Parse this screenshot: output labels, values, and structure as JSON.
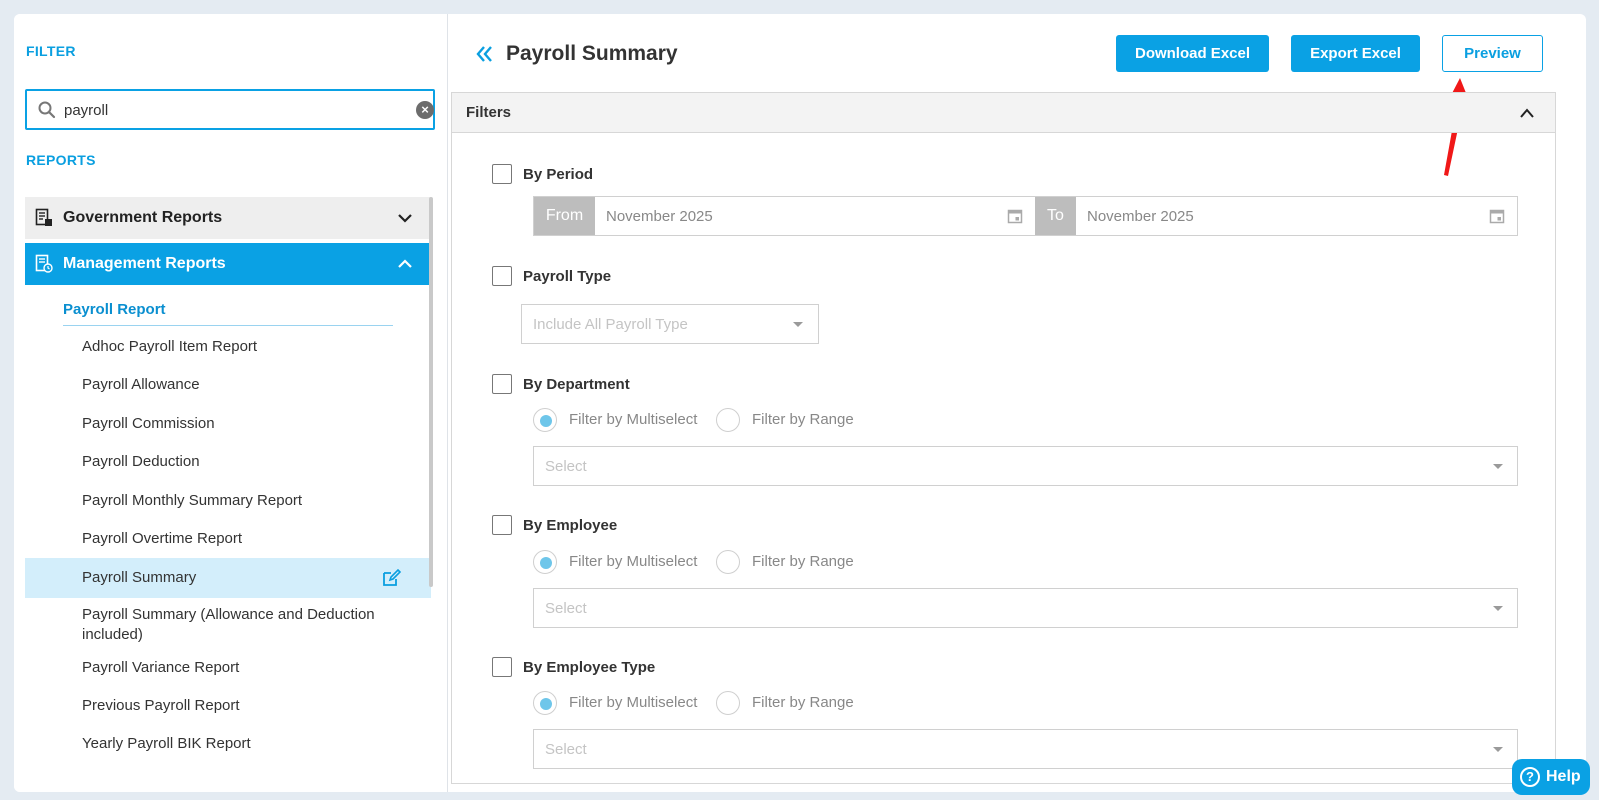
{
  "sidebar": {
    "filter_title": "FILTER",
    "search_value": "payroll",
    "reports_title": "REPORTS",
    "categories": [
      {
        "label": "Government Reports",
        "expanded": false
      },
      {
        "label": "Management Reports",
        "expanded": true
      }
    ],
    "subcategory": "Payroll Report",
    "items": [
      {
        "label": "Adhoc Payroll Item Report"
      },
      {
        "label": "Payroll Allowance"
      },
      {
        "label": "Payroll Commission"
      },
      {
        "label": "Payroll Deduction"
      },
      {
        "label": "Payroll Monthly Summary Report"
      },
      {
        "label": "Payroll Overtime Report"
      },
      {
        "label": "Payroll Summary",
        "active": true
      },
      {
        "label": "Payroll Summary (Allowance and Deduction included)"
      },
      {
        "label": "Payroll Variance Report"
      },
      {
        "label": "Previous Payroll Report"
      },
      {
        "label": "Yearly Payroll BIK Report"
      }
    ]
  },
  "header": {
    "title": "Payroll Summary",
    "download_label": "Download Excel",
    "export_label": "Export Excel",
    "preview_label": "Preview"
  },
  "filters": {
    "title": "Filters",
    "by_period": {
      "label": "By Period",
      "from_label": "From",
      "from_value": "November 2025",
      "to_label": "To",
      "to_value": "November 2025"
    },
    "payroll_type": {
      "label": "Payroll Type",
      "placeholder": "Include All Payroll Type"
    },
    "radio_multiselect": "Filter by Multiselect",
    "radio_range": "Filter by Range",
    "select_placeholder": "Select",
    "by_department": {
      "label": "By Department"
    },
    "by_employee": {
      "label": "By Employee"
    },
    "by_employee_type": {
      "label": "By Employee Type"
    }
  },
  "help_label": "Help",
  "colors": {
    "accent": "#0aa1e4",
    "active_row": "#d3eefb",
    "arrow": "#f01818"
  }
}
